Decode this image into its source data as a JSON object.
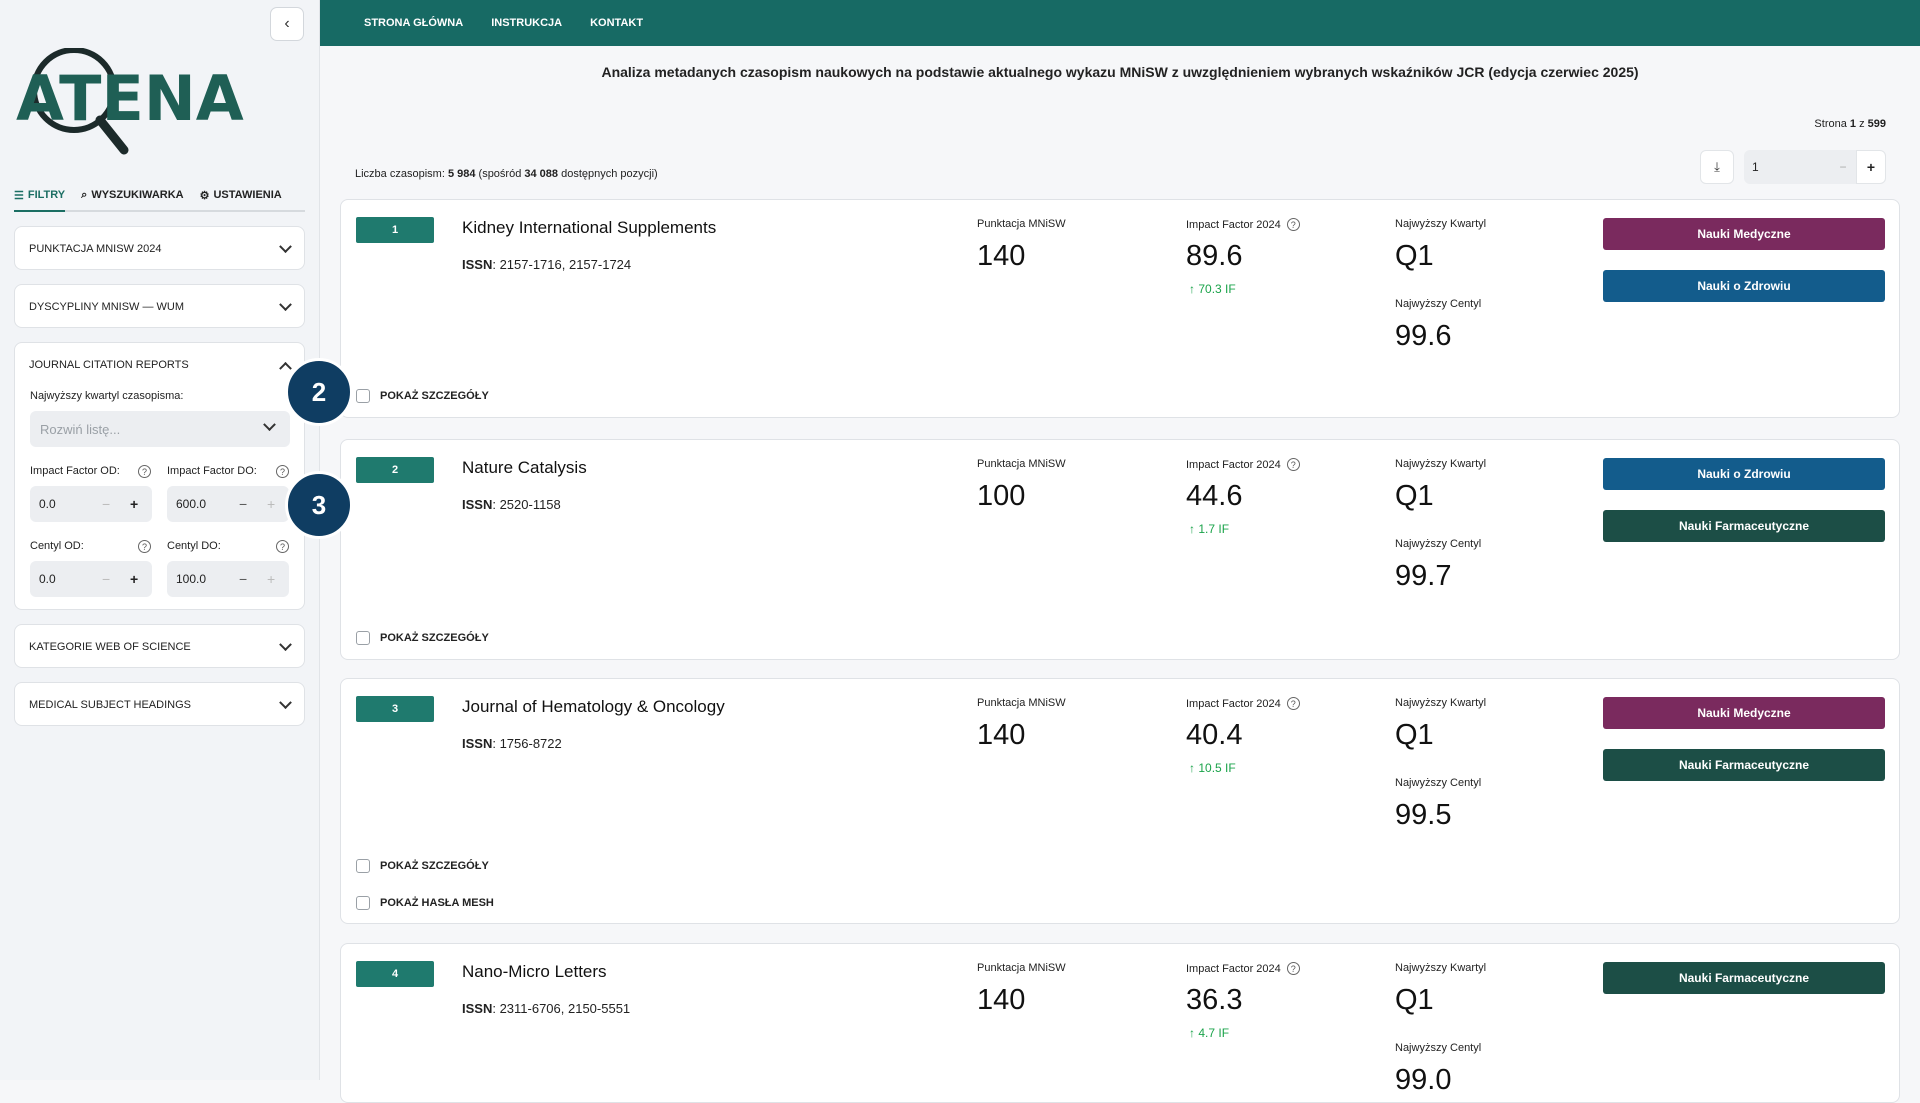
{
  "sidebar": {
    "collapse_label": "‹",
    "logo_text": "ATENA",
    "tabs": [
      {
        "label": "FILTRY",
        "icon": "filter-icon",
        "active": true
      },
      {
        "label": "WYSZUKIWARKA",
        "icon": "search-icon",
        "active": false
      },
      {
        "label": "USTAWIENIA",
        "icon": "gear-icon",
        "active": false
      }
    ],
    "panels": {
      "punktacja": "PUNKTACJA MNISW 2024",
      "dyscypliny": "DYSCYPLINY MNISW — WUM",
      "jcr": "JOURNAL CITATION REPORTS",
      "wos": "KATEGORIE WEB OF SCIENCE",
      "mesh": "MEDICAL SUBJECT HEADINGS"
    },
    "jcr": {
      "quartile_label": "Najwyższy kwartyl czasopisma:",
      "quartile_placeholder": "Rozwiń listę...",
      "if_from_label": "Impact Factor OD:",
      "if_to_label": "Impact Factor DO:",
      "if_from_value": "0.0",
      "if_to_value": "600.0",
      "centyl_from_label": "Centyl OD:",
      "centyl_to_label": "Centyl DO:",
      "centyl_from_value": "0.0",
      "centyl_to_value": "100.0"
    },
    "steps": [
      "2",
      "3"
    ]
  },
  "topbar": {
    "nav": [
      "STRONA GŁÓWNA",
      "INSTRUKCJA",
      "KONTAKT"
    ]
  },
  "main": {
    "heading": "Analiza metadanych czasopism naukowych na podstawie aktualnego wykazu MNiSW z uwzględnieniem wybranych wskaźników JCR (edycja czerwiec 2025)",
    "page_prefix": "Strona ",
    "page_current": "1",
    "page_sep": " z ",
    "page_total": "599",
    "count_prefix": "Liczba czasopism: ",
    "count": "5 984",
    "count_mid": " (spośród ",
    "count_total": "34 088",
    "count_suffix": " dostępnych pozycji)",
    "page_input": "1",
    "labels": {
      "punktacja": "Punktacja MNiSW",
      "impact": "Impact Factor 2024",
      "kwartyl": "Najwyższy Kwartyl",
      "centyl": "Najwyższy Centyl",
      "issn": "ISSN",
      "details": "POKAŻ SZCZEGÓŁY",
      "mesh": "POKAŻ HASŁA MESH"
    },
    "journals": [
      {
        "rank": "1",
        "title": "Kidney International Supplements",
        "issn": ": 2157-1716, 2157-1724",
        "punktacja": "140",
        "impact": "89.6",
        "delta": "70.3 IF",
        "kwartyl": "Q1",
        "centyl": "99.6",
        "tags": [
          {
            "label": "Nauki Medyczne",
            "color": "#7a2a5e"
          },
          {
            "label": "Nauki o Zdrowiu",
            "color": "#135c8c"
          }
        ]
      },
      {
        "rank": "2",
        "title": "Nature Catalysis",
        "issn": ": 2520-1158",
        "punktacja": "100",
        "impact": "44.6",
        "delta": "1.7 IF",
        "kwartyl": "Q1",
        "centyl": "99.7",
        "tags": [
          {
            "label": "Nauki o Zdrowiu",
            "color": "#135c8c"
          },
          {
            "label": "Nauki Farmaceutyczne",
            "color": "#1c4e46"
          }
        ]
      },
      {
        "rank": "3",
        "title": "Journal of Hematology & Oncology",
        "issn": ": 1756-8722",
        "punktacja": "140",
        "impact": "40.4",
        "delta": "10.5 IF",
        "kwartyl": "Q1",
        "centyl": "99.5",
        "tags": [
          {
            "label": "Nauki Medyczne",
            "color": "#7a2a5e"
          },
          {
            "label": "Nauki Farmaceutyczne",
            "color": "#1c4e46"
          }
        ]
      },
      {
        "rank": "4",
        "title": "Nano-Micro Letters",
        "issn": ": 2311-6706, 2150-5551",
        "punktacja": "140",
        "impact": "36.3",
        "delta": "4.7 IF",
        "kwartyl": "Q1",
        "centyl": "99.0",
        "tags": [
          {
            "label": "Nauki Farmaceutyczne",
            "color": "#1c4e46"
          }
        ]
      }
    ]
  }
}
